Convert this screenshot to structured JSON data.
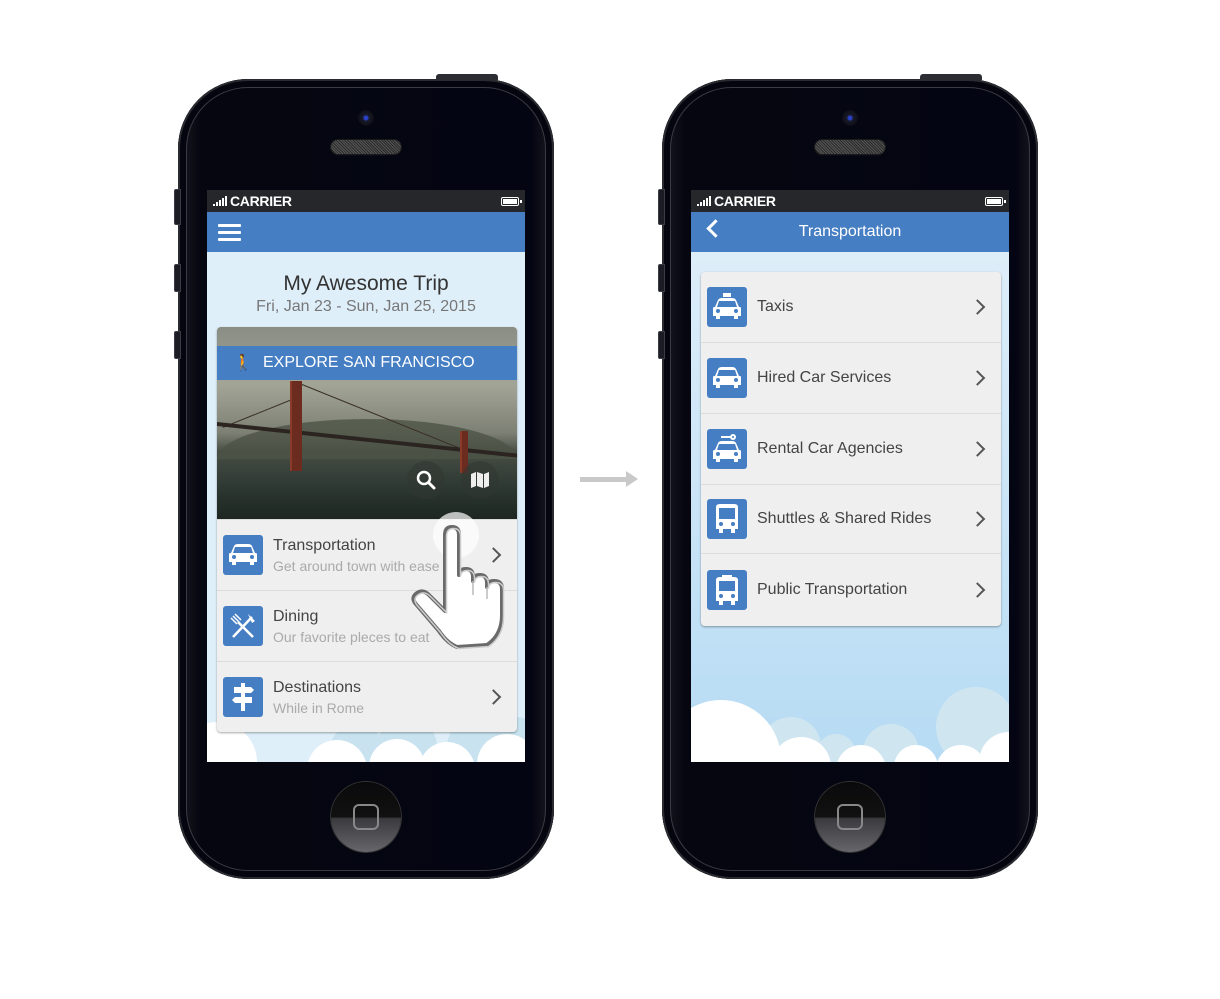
{
  "left_phone": {
    "status_bar": {
      "carrier": "CARRIER"
    },
    "navbar": {
      "menu_icon": "hamburger-menu-icon"
    },
    "trip": {
      "title": "My Awesome Trip",
      "dates": "Fri, Jan 23 - Sun, Jan 25, 2015"
    },
    "explore": {
      "label_bold": "EXPLORE",
      "label_city": " SAN FRANCISCO",
      "icon": "walking-person-icon",
      "image": "golden-gate-bridge-photo",
      "actions": [
        {
          "name": "search",
          "icon": "search-icon"
        },
        {
          "name": "map",
          "icon": "map-icon"
        }
      ]
    },
    "menu": [
      {
        "title": "Transportation",
        "subtitle": "Get around town with ease",
        "icon": "car-icon"
      },
      {
        "title": "Dining",
        "subtitle": "Our favorite pleces to eat",
        "icon": "fork-knife-icon"
      },
      {
        "title": "Destinations",
        "subtitle": "While in Rome",
        "icon": "signpost-icon"
      }
    ]
  },
  "right_phone": {
    "status_bar": {
      "carrier": "CARRIER"
    },
    "navbar": {
      "title": "Transportation",
      "back_icon": "back-chevron-icon"
    },
    "menu": [
      {
        "title": "Taxis",
        "icon": "taxi-icon"
      },
      {
        "title": "Hired Car Services",
        "icon": "car-icon"
      },
      {
        "title": "Rental Car Agencies",
        "icon": "rental-car-key-icon"
      },
      {
        "title": "Shuttles & Shared Rides",
        "icon": "shuttle-bus-icon"
      },
      {
        "title": "Public Transportation",
        "icon": "public-bus-icon"
      }
    ]
  },
  "flow_arrow": {
    "icon": "right-arrow-icon"
  },
  "colors": {
    "brand_blue": "#467ec3",
    "status_bar": "#26272b",
    "sky": "#dfeffa",
    "card_bg": "#efefef"
  }
}
